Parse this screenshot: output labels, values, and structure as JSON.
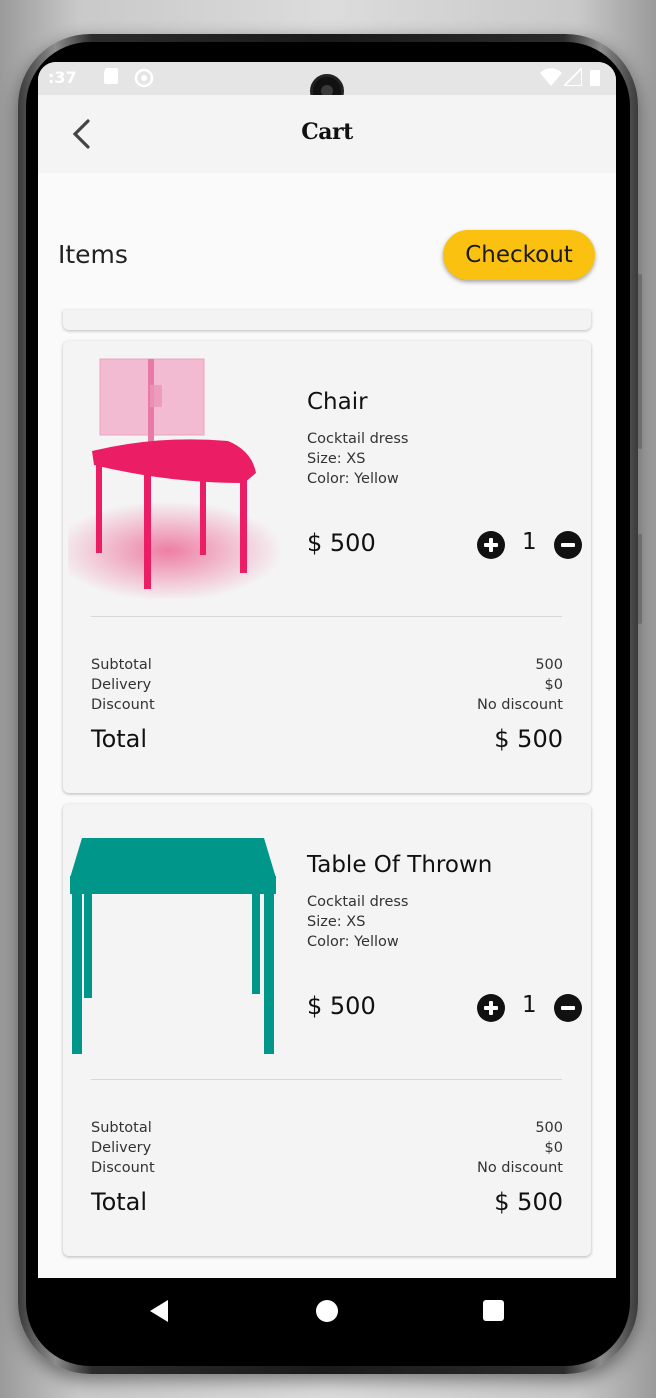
{
  "status_bar": {
    "time": ":37"
  },
  "header": {
    "title": "Cart",
    "back_icon": "chevron-left-icon"
  },
  "section": {
    "label": "Items",
    "checkout_label": "Checkout"
  },
  "colors": {
    "accent": "#fbc110",
    "chair": "#e91e63",
    "table": "#00968a"
  },
  "cart": [
    {
      "name": "Chair",
      "description": "Cocktail dress",
      "size": "Size: XS",
      "color": "Color: Yellow",
      "price": "$ 500",
      "quantity": "1",
      "subtotal_label": "Subtotal",
      "subtotal": "500",
      "delivery_label": "Delivery",
      "delivery": "$0",
      "discount_label": "Discount",
      "discount": "No discount",
      "total_label": "Total",
      "total": "$ 500"
    },
    {
      "name": "Table Of Thrown",
      "description": "Cocktail dress",
      "size": "Size: XS",
      "color": "Color: Yellow",
      "price": "$ 500",
      "quantity": "1",
      "subtotal_label": "Subtotal",
      "subtotal": "500",
      "delivery_label": "Delivery",
      "delivery": "$0",
      "discount_label": "Discount",
      "discount": "No discount",
      "total_label": "Total",
      "total": "$ 500"
    }
  ]
}
